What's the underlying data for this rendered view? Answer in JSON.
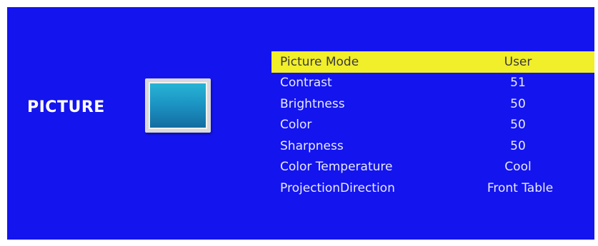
{
  "menu": {
    "section_title": "PICTURE",
    "section_icon": "picture-icon",
    "colors": {
      "background": "#1414ee",
      "highlight": "#f1ee2a",
      "text": "#ffffff"
    },
    "items": [
      {
        "label": "Picture Mode",
        "value": "User",
        "selected": true
      },
      {
        "label": "Contrast",
        "value": "51",
        "selected": false
      },
      {
        "label": "Brightness",
        "value": "50",
        "selected": false
      },
      {
        "label": "Color",
        "value": "50",
        "selected": false
      },
      {
        "label": "Sharpness",
        "value": "50",
        "selected": false
      },
      {
        "label": "Color Temperature",
        "value": "Cool",
        "selected": false
      },
      {
        "label": "ProjectionDirection",
        "value": "Front Table",
        "selected": false
      }
    ]
  }
}
